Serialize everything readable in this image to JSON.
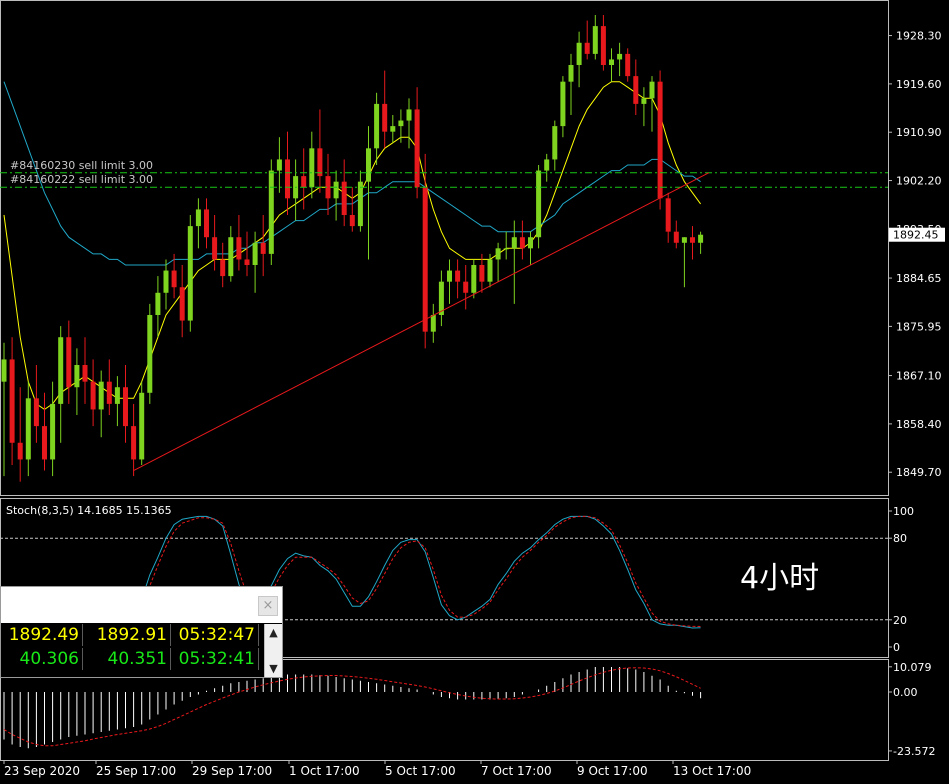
{
  "chart_data": [
    {
      "type": "candlestick",
      "title": "",
      "xlabel": "",
      "ylabel": "",
      "x_tick_labels": [
        "23 Sep 2020",
        "25 Sep 17:00",
        "29 Sep 17:00",
        "1 Oct 17:00",
        "5 Oct 17:00",
        "7 Oct 17:00",
        "9 Oct 17:00",
        "13 Oct 17:00"
      ],
      "y_tick_labels": [
        "1928.30",
        "1919.60",
        "1910.90",
        "1902.20",
        "1893.50",
        "1884.65",
        "1875.95",
        "1867.10",
        "1858.40",
        "1849.70"
      ],
      "ylim": [
        1846.5,
        1933.8
      ],
      "current_price_label": "1892.45",
      "current_price": 1892.45,
      "up_color": "#7fd41f",
      "down_color": "#e8191c",
      "ohlc": [
        [
          1866.0,
          1873.0,
          1849.0,
          1870.0
        ],
        [
          1870.0,
          1874.0,
          1851.0,
          1855.0
        ],
        [
          1855.0,
          1865.0,
          1848.0,
          1852.0
        ],
        [
          1852.0,
          1866.0,
          1849.0,
          1863.0
        ],
        [
          1863.0,
          1869.0,
          1855.0,
          1858.0
        ],
        [
          1858.0,
          1864.0,
          1850.0,
          1852.0
        ],
        [
          1852.0,
          1866.0,
          1849.0,
          1862.0
        ],
        [
          1862.0,
          1876.0,
          1855.0,
          1874.0
        ],
        [
          1874.0,
          1877.0,
          1862.0,
          1865.0
        ],
        [
          1865.0,
          1872.0,
          1860.0,
          1869.0
        ],
        [
          1869.0,
          1874.0,
          1862.0,
          1866.0
        ],
        [
          1866.0,
          1870.0,
          1858.0,
          1861.0
        ],
        [
          1861.0,
          1868.0,
          1856.0,
          1866.0
        ],
        [
          1866.0,
          1870.0,
          1860.0,
          1862.0
        ],
        [
          1862.0,
          1867.0,
          1858.0,
          1865.0
        ],
        [
          1865.0,
          1869.0,
          1855.0,
          1858.0
        ],
        [
          1858.0,
          1862.0,
          1849.0,
          1852.0
        ],
        [
          1852.0,
          1866.0,
          1851.0,
          1864.0
        ],
        [
          1864.0,
          1880.0,
          1862.0,
          1878.0
        ],
        [
          1878.0,
          1885.0,
          1874.0,
          1882.0
        ],
        [
          1882.0,
          1888.0,
          1879.0,
          1886.0
        ],
        [
          1886.0,
          1889.0,
          1881.0,
          1883.0
        ],
        [
          1883.0,
          1887.0,
          1874.0,
          1877.0
        ],
        [
          1877.0,
          1896.0,
          1875.0,
          1894.0
        ],
        [
          1894.0,
          1899.0,
          1890.0,
          1897.0
        ],
        [
          1897.0,
          1899.0,
          1890.0,
          1892.0
        ],
        [
          1892.0,
          1896.0,
          1886.0,
          1888.0
        ],
        [
          1888.0,
          1891.0,
          1883.0,
          1885.0
        ],
        [
          1885.0,
          1894.0,
          1884.0,
          1892.0
        ],
        [
          1892.0,
          1896.0,
          1886.0,
          1888.0
        ],
        [
          1888.0,
          1893.0,
          1885.0,
          1887.0
        ],
        [
          1887.0,
          1893.0,
          1882.0,
          1891.0
        ],
        [
          1891.0,
          1896.0,
          1885.0,
          1889.0
        ],
        [
          1889.0,
          1906.0,
          1887.0,
          1904.0
        ],
        [
          1904.0,
          1910.0,
          1900.0,
          1906.0
        ],
        [
          1906.0,
          1911.0,
          1896.0,
          1899.0
        ],
        [
          1899.0,
          1906.0,
          1895.0,
          1903.0
        ],
        [
          1903.0,
          1908.0,
          1897.0,
          1901.0
        ],
        [
          1901.0,
          1911.0,
          1899.0,
          1908.0
        ],
        [
          1908.0,
          1915.0,
          1900.0,
          1903.0
        ],
        [
          1903.0,
          1907.0,
          1896.0,
          1899.0
        ],
        [
          1899.0,
          1904.0,
          1895.0,
          1902.0
        ],
        [
          1902.0,
          1906.0,
          1894.0,
          1896.0
        ],
        [
          1896.0,
          1901.0,
          1893.0,
          1894.0
        ],
        [
          1894.0,
          1904.0,
          1893.0,
          1902.0
        ],
        [
          1902.0,
          1912.0,
          1888.0,
          1908.0
        ],
        [
          1908.0,
          1918.0,
          1905.0,
          1916.0
        ],
        [
          1916.0,
          1922.0,
          1908.0,
          1911.0
        ],
        [
          1911.0,
          1914.0,
          1909.0,
          1912.0
        ],
        [
          1912.0,
          1915.0,
          1909.0,
          1913.0
        ],
        [
          1913.0,
          1917.0,
          1908.0,
          1915.0
        ],
        [
          1915.0,
          1919.0,
          1899.0,
          1901.0
        ],
        [
          1901.0,
          1907.0,
          1872.0,
          1875.0
        ],
        [
          1875.0,
          1880.0,
          1873.0,
          1878.0
        ],
        [
          1878.0,
          1886.0,
          1876.0,
          1884.0
        ],
        [
          1884.0,
          1888.0,
          1880.0,
          1886.0
        ],
        [
          1886.0,
          1888.0,
          1881.0,
          1884.0
        ],
        [
          1884.0,
          1887.0,
          1879.0,
          1882.0
        ],
        [
          1882.0,
          1888.0,
          1881.0,
          1887.0
        ],
        [
          1887.0,
          1889.0,
          1882.0,
          1884.0
        ],
        [
          1884.0,
          1889.0,
          1883.0,
          1888.0
        ],
        [
          1888.0,
          1891.0,
          1884.0,
          1890.0
        ],
        [
          1890.0,
          1893.0,
          1888.0,
          1890.0
        ],
        [
          1890.0,
          1895.0,
          1880.0,
          1892.0
        ],
        [
          1892.0,
          1895.0,
          1888.0,
          1890.0
        ],
        [
          1890.0,
          1893.0,
          1887.0,
          1892.0
        ],
        [
          1892.0,
          1905.0,
          1890.0,
          1904.0
        ],
        [
          1904.0,
          1907.0,
          1902.0,
          1906.0
        ],
        [
          1906.0,
          1913.0,
          1904.0,
          1912.0
        ],
        [
          1912.0,
          1921.0,
          1910.0,
          1920.0
        ],
        [
          1920.0,
          1925.0,
          1914.0,
          1923.0
        ],
        [
          1923.0,
          1929.0,
          1919.0,
          1927.0
        ],
        [
          1927.0,
          1931.0,
          1924.0,
          1925.0
        ],
        [
          1925.0,
          1932.0,
          1924.0,
          1930.0
        ],
        [
          1930.0,
          1932.0,
          1922.0,
          1923.0
        ],
        [
          1923.0,
          1926.0,
          1920.0,
          1924.0
        ],
        [
          1924.0,
          1927.0,
          1921.0,
          1925.0
        ],
        [
          1925.0,
          1926.0,
          1920.0,
          1921.0
        ],
        [
          1921.0,
          1924.0,
          1914.0,
          1916.0
        ],
        [
          1916.0,
          1919.0,
          1912.0,
          1917.0
        ],
        [
          1917.0,
          1921.0,
          1911.0,
          1920.0
        ],
        [
          1920.0,
          1922.0,
          1897.0,
          1899.0
        ],
        [
          1899.0,
          1900.0,
          1891.0,
          1893.0
        ],
        [
          1893.0,
          1895.0,
          1890.0,
          1891.0
        ],
        [
          1891.0,
          1892.0,
          1883.0,
          1892.0
        ],
        [
          1892.0,
          1894.0,
          1888.0,
          1891.0
        ],
        [
          1891.0,
          1893.0,
          1889.0,
          1892.45
        ]
      ],
      "series": [
        {
          "name": "",
          "color": "#ffff00",
          "values": [
            1896.0,
            1885.0,
            1874.0,
            1866.0,
            1862.0,
            1861.0,
            1862.0,
            1864.0,
            1865.0,
            1866.0,
            1867.0,
            1866.0,
            1865.0,
            1864.0,
            1863.0,
            1863.0,
            1863.0,
            1866.0,
            1870.0,
            1874.0,
            1878.0,
            1880.0,
            1882.0,
            1884.0,
            1886.0,
            1887.0,
            1888.0,
            1888.0,
            1888.0,
            1889.0,
            1890.0,
            1891.0,
            1892.0,
            1894.0,
            1896.0,
            1897.0,
            1898.0,
            1899.0,
            1900.0,
            1901.0,
            1901.0,
            1901.0,
            1900.0,
            1899.0,
            1900.0,
            1903.0,
            1906.0,
            1908.0,
            1909.0,
            1910.0,
            1910.0,
            1908.0,
            1902.0,
            1897.0,
            1893.0,
            1890.0,
            1889.0,
            1888.0,
            1888.0,
            1888.0,
            1888.0,
            1889.0,
            1890.0,
            1890.0,
            1890.0,
            1891.0,
            1893.0,
            1896.0,
            1900.0,
            1904.0,
            1908.0,
            1912.0,
            1915.0,
            1917.0,
            1919.0,
            1920.0,
            1920.0,
            1919.0,
            1918.0,
            1917.0,
            1917.0,
            1914.0,
            1909.0,
            1905.0,
            1902.0,
            1900.0,
            1898.0
          ]
        },
        {
          "name": "",
          "color": "#20a8c8",
          "values": [
            1920.0,
            1916.0,
            1912.0,
            1908.0,
            1904.0,
            1900.0,
            1897.0,
            1894.0,
            1892.0,
            1891.0,
            1890.0,
            1889.0,
            1889.0,
            1888.0,
            1888.0,
            1887.0,
            1887.0,
            1887.0,
            1887.0,
            1887.0,
            1887.0,
            1888.0,
            1888.0,
            1888.0,
            1888.0,
            1889.0,
            1889.0,
            1889.0,
            1889.0,
            1890.0,
            1890.0,
            1891.0,
            1891.0,
            1892.0,
            1893.0,
            1894.0,
            1895.0,
            1895.0,
            1896.0,
            1897.0,
            1897.0,
            1898.0,
            1898.0,
            1898.0,
            1899.0,
            1900.0,
            1900.0,
            1901.0,
            1902.0,
            1902.0,
            1902.0,
            1902.0,
            1901.0,
            1900.0,
            1899.0,
            1898.0,
            1897.0,
            1896.0,
            1895.0,
            1894.0,
            1894.0,
            1893.0,
            1893.0,
            1893.0,
            1893.0,
            1893.0,
            1894.0,
            1895.0,
            1896.0,
            1898.0,
            1899.0,
            1900.0,
            1901.0,
            1902.0,
            1903.0,
            1904.0,
            1904.0,
            1905.0,
            1905.0,
            1905.0,
            1906.0,
            1906.0,
            1905.0,
            1904.0,
            1903.0,
            1903.0,
            1902.0
          ]
        }
      ],
      "lines": [
        {
          "label": "#84160230 sell limit 3.00",
          "value": 1903.6,
          "color": "#18c818",
          "style": "dashdot"
        },
        {
          "label": "#84160222 sell limit 3.00",
          "value": 1901.0,
          "color": "#18c818",
          "style": "dashdot"
        }
      ],
      "trendline": {
        "color": "#e8191c",
        "from": [
          16.0,
          1850.0
        ],
        "to": [
          87.0,
          1903.6
        ]
      },
      "annotation": "4小时"
    },
    {
      "type": "line",
      "title": "Stoch(8,3,5) 14.1685 15.1365",
      "y_tick_labels": [
        "100",
        "80",
        "20",
        "0"
      ],
      "ylim": [
        0,
        100
      ],
      "levels": [
        80,
        20
      ],
      "series": [
        {
          "name": "Stoch(8,3,5)",
          "color": "#20a8c8",
          "style": "solid",
          "values": [
            10.0,
            25.0,
            34.0,
            38.0,
            37.0,
            33.0,
            25.0,
            20.0,
            18.0,
            19.0,
            21.0,
            22.0,
            24.0,
            28.0,
            28.0,
            25.0,
            22.0,
            35.0,
            53.0,
            66.0,
            80.0,
            90.0,
            94.0,
            95.0,
            96.0,
            96.0,
            94.0,
            89.0,
            68.0,
            46.0,
            30.0,
            28.0,
            35.0,
            45.0,
            57.0,
            65.0,
            69.0,
            67.0,
            66.0,
            60.0,
            56.0,
            50.0,
            40.0,
            30.0,
            30.0,
            37.0,
            48.0,
            60.0,
            71.0,
            77.0,
            79.0,
            79.0,
            70.0,
            51.0,
            31.0,
            23.0,
            20.0,
            22.0,
            26.0,
            30.0,
            35.0,
            46.0,
            54.0,
            63.0,
            69.0,
            73.0,
            79.0,
            84.0,
            90.0,
            94.0,
            96.0,
            96.0,
            96.0,
            94.0,
            89.0,
            83.0,
            71.0,
            57.0,
            42.0,
            32.0,
            20.0,
            17.0,
            16.0,
            16.0,
            15.0,
            14.0,
            14.2
          ]
        },
        {
          "name": "",
          "color": "#e8191c",
          "style": "dashed",
          "values": [
            12.0,
            22.0,
            30.0,
            35.0,
            36.0,
            35.0,
            30.0,
            24.0,
            20.0,
            19.0,
            20.0,
            21.0,
            23.0,
            26.0,
            27.0,
            26.0,
            24.0,
            30.0,
            45.0,
            60.0,
            74.0,
            85.0,
            91.0,
            93.0,
            95.0,
            95.0,
            94.0,
            91.0,
            76.0,
            56.0,
            38.0,
            31.0,
            32.0,
            40.0,
            51.0,
            60.0,
            66.0,
            66.0,
            66.0,
            62.0,
            58.0,
            53.0,
            45.0,
            36.0,
            32.0,
            34.0,
            43.0,
            54.0,
            65.0,
            73.0,
            77.0,
            78.0,
            73.0,
            57.0,
            38.0,
            27.0,
            22.0,
            22.0,
            24.0,
            28.0,
            33.0,
            42.0,
            50.0,
            59.0,
            66.0,
            71.0,
            77.0,
            82.0,
            88.0,
            92.0,
            95.0,
            96.0,
            96.0,
            95.0,
            91.0,
            86.0,
            75.0,
            62.0,
            47.0,
            36.0,
            25.0,
            19.0,
            17.0,
            16.0,
            15.5,
            15.2,
            15.1
          ]
        }
      ]
    },
    {
      "type": "bar",
      "title": "",
      "y_tick_labels": [
        "10.079",
        "0.00",
        "-23.572"
      ],
      "ylim": [
        -26.0,
        12.0
      ],
      "bar_color": "#ffffff",
      "signal_color": "#e8191c",
      "values": [
        -19.0,
        -21.0,
        -22.0,
        -22.5,
        -22.0,
        -21.0,
        -20.0,
        -19.0,
        -18.0,
        -17.5,
        -17.0,
        -16.5,
        -16.0,
        -15.5,
        -15.0,
        -14.5,
        -14.0,
        -13.0,
        -11.0,
        -9.0,
        -7.0,
        -5.0,
        -3.5,
        -2.0,
        -1.0,
        0.5,
        1.5,
        2.5,
        3.5,
        4.0,
        4.5,
        5.0,
        5.5,
        6.0,
        6.5,
        7.0,
        7.0,
        7.0,
        7.0,
        6.8,
        6.5,
        6.0,
        5.5,
        5.0,
        4.5,
        4.0,
        3.5,
        3.0,
        2.5,
        2.0,
        1.5,
        1.0,
        0.0,
        -1.0,
        -2.0,
        -2.5,
        -3.0,
        -3.0,
        -3.0,
        -3.0,
        -3.0,
        -2.8,
        -2.5,
        -2.0,
        -1.0,
        0.0,
        1.0,
        2.5,
        4.0,
        5.5,
        7.0,
        8.0,
        9.0,
        10.0,
        10.0,
        10.0,
        10.0,
        9.5,
        9.0,
        8.0,
        6.5,
        5.0,
        2.5,
        0.5,
        -0.5,
        -1.5,
        -2.5
      ],
      "signal": [
        -15.0,
        -17.0,
        -18.5,
        -20.0,
        -21.0,
        -21.5,
        -21.5,
        -21.0,
        -20.5,
        -20.0,
        -19.5,
        -18.8,
        -18.2,
        -17.6,
        -17.0,
        -16.5,
        -16.0,
        -15.5,
        -14.8,
        -13.8,
        -12.5,
        -11.0,
        -9.5,
        -8.0,
        -6.5,
        -5.0,
        -3.7,
        -2.4,
        -1.2,
        0.0,
        1.0,
        2.0,
        2.9,
        3.7,
        4.4,
        5.1,
        5.6,
        6.0,
        6.3,
        6.5,
        6.6,
        6.6,
        6.4,
        6.2,
        5.9,
        5.5,
        5.1,
        4.6,
        4.1,
        3.6,
        3.1,
        2.6,
        2.0,
        1.3,
        0.5,
        -0.3,
        -1.0,
        -1.6,
        -2.1,
        -2.5,
        -2.7,
        -2.8,
        -2.8,
        -2.7,
        -2.4,
        -2.0,
        -1.4,
        -0.6,
        0.4,
        1.6,
        3.0,
        4.4,
        5.7,
        6.9,
        7.9,
        8.7,
        9.3,
        9.6,
        9.7,
        9.6,
        9.2,
        8.5,
        7.4,
        6.1,
        4.6,
        3.1,
        1.5
      ]
    }
  ],
  "quote_window": {
    "close_label": "×",
    "scroll_up": "▲",
    "scroll_down": "▼",
    "rows": [
      {
        "bid": "1892.49",
        "ask": "1892.91",
        "time": "05:32:47",
        "color": "#ffff00"
      },
      {
        "bid": "40.306",
        "ask": "40.351",
        "time": "05:32:41",
        "color": "#18e818"
      }
    ]
  }
}
